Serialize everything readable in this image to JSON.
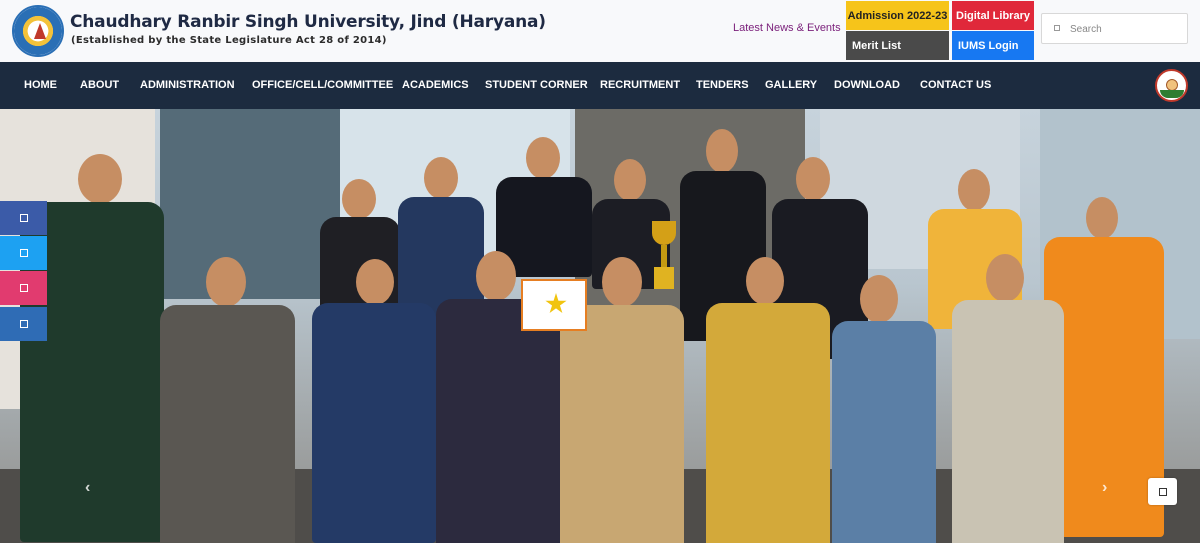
{
  "header": {
    "title": "Chaudhary Ranbir Singh University, Jind (Haryana)",
    "subtitle": "(Established by the State Legislature Act 28 of 2014)",
    "news_link": "Latest News & Events",
    "quick_links": {
      "admission": "Admission 2022-23",
      "library": "Digital Library",
      "merit": "Merit List",
      "iums": "IUMS Login"
    },
    "search": {
      "placeholder": "Search",
      "value": ""
    }
  },
  "nav": {
    "items": [
      "HOME",
      "ABOUT",
      "ADMINISTRATION",
      "OFFICE/CELL/COMMITTEE",
      "ACADEMICS",
      "STUDENT CORNER",
      "RECRUITMENT",
      "TENDERS",
      "GALLERY",
      "DOWNLOAD",
      "CONTACT US"
    ]
  },
  "hero": {
    "prev_glyph": "‹",
    "next_glyph": "›"
  },
  "social": [
    "facebook-icon",
    "twitter-icon",
    "instagram-icon",
    "linkedin-icon"
  ],
  "colors": {
    "nav_bg": "#1c2b3f",
    "admission": "#f6c41a",
    "library": "#e0283a",
    "merit": "#4a4a4a",
    "iums": "#1778f2",
    "news_link": "#7a1f7a"
  }
}
